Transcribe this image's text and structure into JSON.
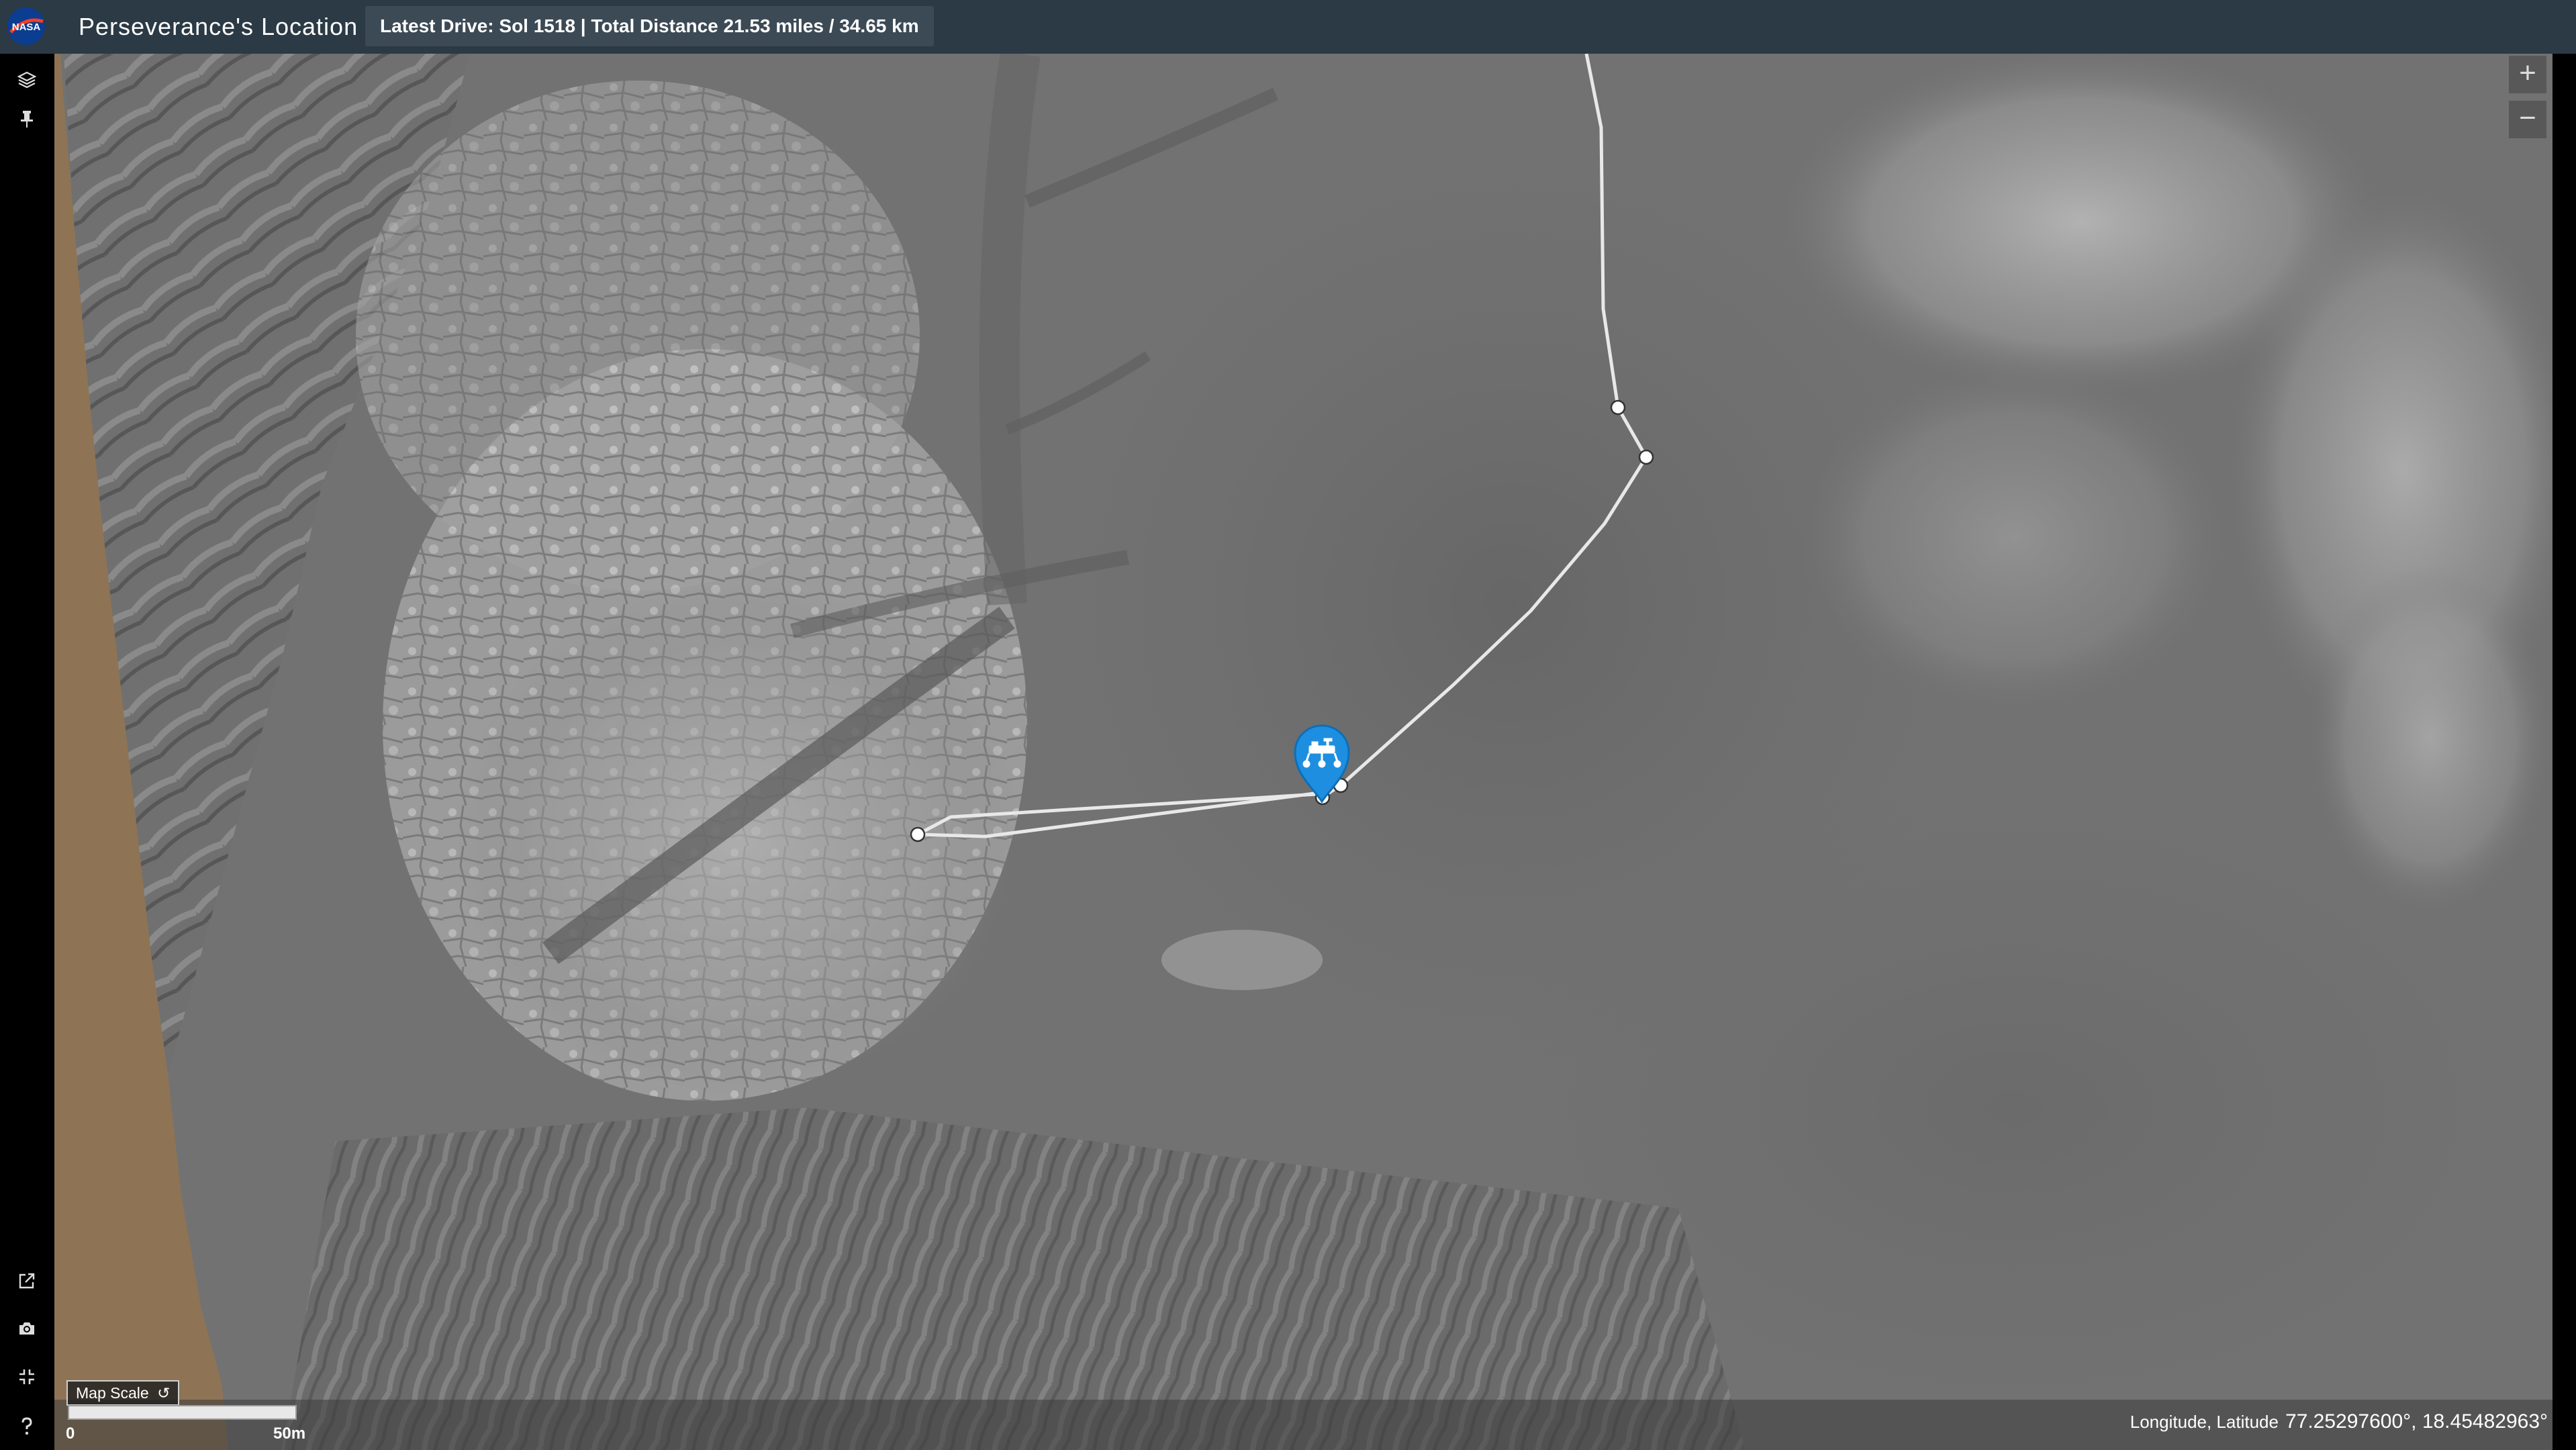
{
  "header": {
    "logo_text": "NASA",
    "title": "Perseverance's Location",
    "drive_info": "Latest Drive: Sol 1518 | Total Distance 21.53 miles / 34.65 km"
  },
  "left_rail": {
    "top_tools": [
      "layers-icon",
      "pin-icon"
    ],
    "bottom_tools": [
      "external-link-icon",
      "camera-icon",
      "collapse-icon",
      "help-icon"
    ]
  },
  "map_controls": {
    "zoom_in": "+",
    "zoom_out": "−"
  },
  "scale": {
    "label": "Map Scale",
    "reset_icon": "↺",
    "start": "0",
    "end": "50m"
  },
  "coordinates": {
    "label": "Longitude, Latitude",
    "value": "77.25297600°, 18.45482963°"
  },
  "colors": {
    "header": "#2b3a45",
    "marker": "#1e8fe0",
    "traverse": "#e8e8e8"
  }
}
